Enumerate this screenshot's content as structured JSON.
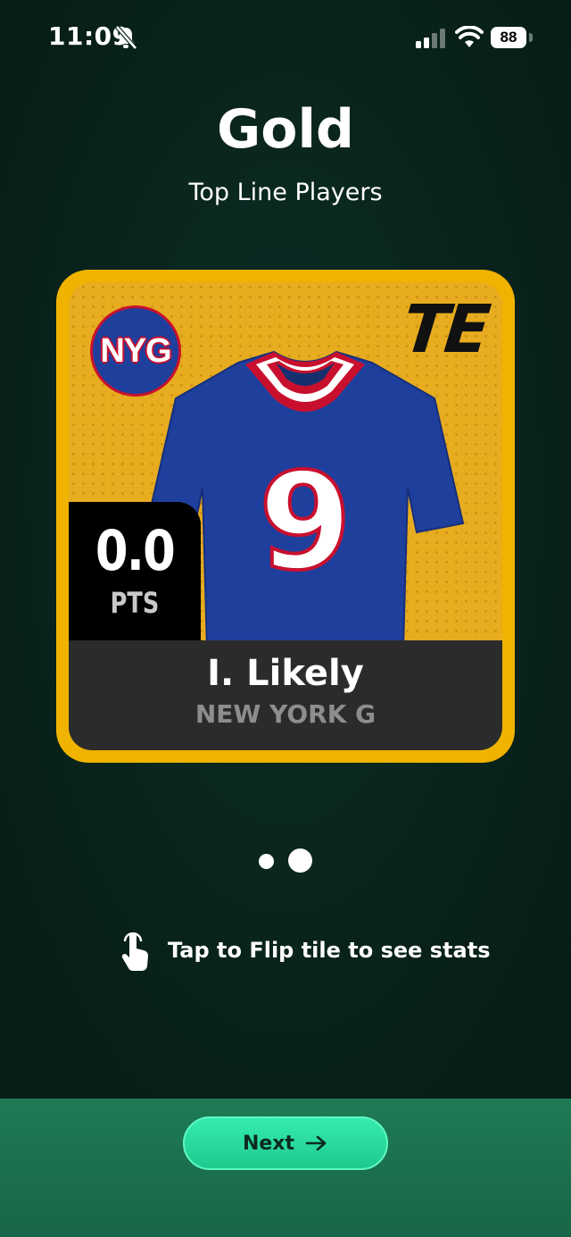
{
  "status_bar": {
    "time": "11:09",
    "battery": "88",
    "icons": [
      "bell-slash-icon",
      "signal-icon",
      "wifi-icon",
      "battery-icon"
    ]
  },
  "header": {
    "title": "Gold",
    "subtitle": "Top Line Players"
  },
  "card": {
    "team_logo": "NYG",
    "position": "TE",
    "jersey_number": "9",
    "score": "0.0",
    "score_unit": "PTS",
    "player_name": "I. Likely",
    "team_name": "NEW YORK G",
    "colors": {
      "frame": "#efb300",
      "background": "#e7ac1f",
      "jersey": "#1f3f9d",
      "trim": "#c8102e",
      "name_bar": "#2b2b2b"
    }
  },
  "pager": {
    "count": 2,
    "active_index": 1
  },
  "hint": {
    "icon": "tap-hand-icon",
    "text": "Tap to Flip tile to see stats"
  },
  "footer": {
    "next_label": "Next",
    "next_icon": "arrow-right-icon",
    "accent": "#2ee0a0"
  }
}
